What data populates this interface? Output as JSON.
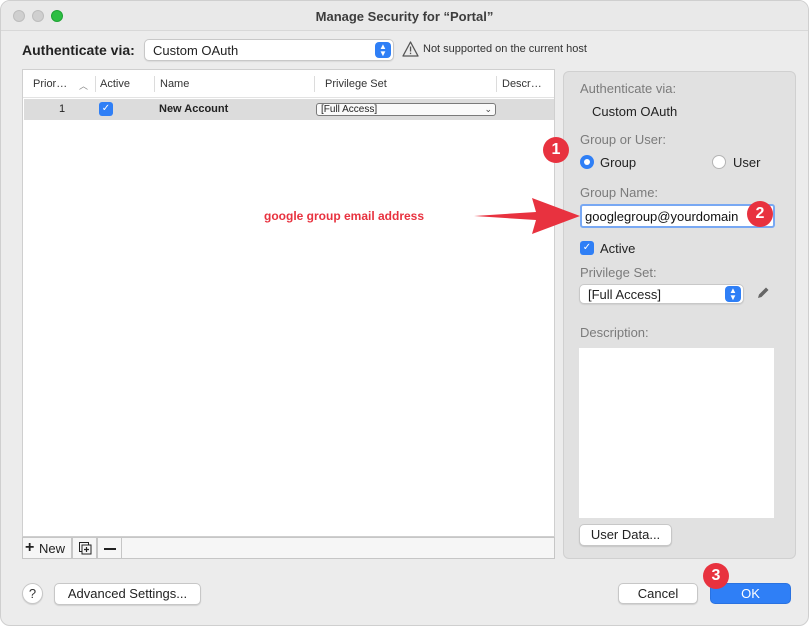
{
  "window": {
    "title": "Manage Security for “Portal”"
  },
  "auth": {
    "label": "Authenticate via:",
    "selected": "Custom OAuth",
    "warning": "Not supported on the current host"
  },
  "table": {
    "columns": [
      "Prior…",
      "Active",
      "Name",
      "Privilege Set",
      "Descr…"
    ],
    "rows": [
      {
        "priority": "1",
        "active": true,
        "name": "New Account",
        "privilege_set": "[Full Access]"
      }
    ],
    "footer": {
      "new_label": "New"
    }
  },
  "panel": {
    "auth_label": "Authenticate via:",
    "auth_value": "Custom OAuth",
    "group_or_user_label": "Group or User:",
    "group_label": "Group",
    "user_label": "User",
    "group_selected": true,
    "group_name_label": "Group Name:",
    "group_name_value": "googlegroup@yourdomain",
    "active_label": "Active",
    "active_checked": true,
    "privilege_label": "Privilege Set:",
    "privilege_value": "[Full Access]",
    "description_label": "Description:",
    "user_data_button": "User Data..."
  },
  "bottom": {
    "help_label": "?",
    "advanced_button": "Advanced Settings...",
    "cancel_button": "Cancel",
    "ok_button": "OK"
  },
  "annotations": {
    "badge1": "1",
    "badge2": "2",
    "badge3": "3",
    "note": "google group email address",
    "color": "#e8323f"
  },
  "colors": {
    "accent": "#2f7ff6",
    "annotation": "#e8323f"
  }
}
